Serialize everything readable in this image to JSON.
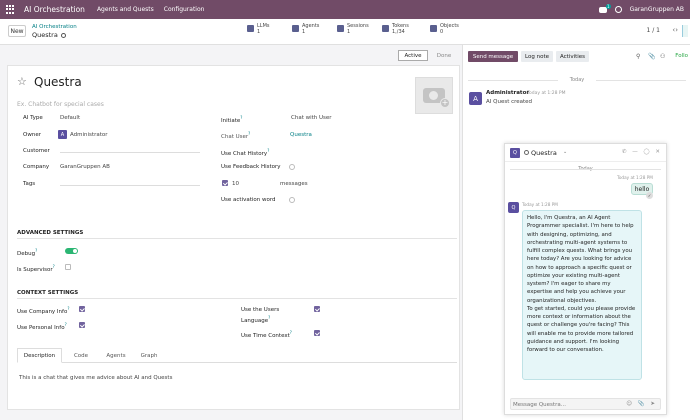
{
  "topbar": {
    "app_name": "AI Orchestration",
    "menu": [
      "Agents and Quests",
      "Configuration"
    ],
    "chat_badge": "1",
    "company": "GaranGruppen AB"
  },
  "controlbar": {
    "new_label": "New",
    "breadcrumb_parent": "AI Orchestration",
    "breadcrumb_current": "Questra",
    "stats": [
      {
        "label": "LLMs",
        "value": "1"
      },
      {
        "label": "Agents",
        "value": "1"
      },
      {
        "label": "Sessions",
        "value": "1"
      },
      {
        "label": "Tokens",
        "value": "1,/34"
      },
      {
        "label": "Objects",
        "value": "0"
      }
    ],
    "pager": "1 / 1"
  },
  "status": {
    "active": "Active",
    "done": "Done"
  },
  "form": {
    "name": "Questra",
    "subtitle": "Ex. Chatbot for special cases",
    "ai_type_label": "AI Type",
    "ai_type_value": "Default",
    "owner_label": "Owner",
    "owner_avatar": "A",
    "owner_value": "Administrator",
    "customer_label": "Customer",
    "company_label": "Company",
    "company_value": "GaranGruppen AB",
    "tags_label": "Tags",
    "initiate_label": "Initiate",
    "initiate_sup": "?",
    "initiate_value": "Chat with User",
    "chat_user_label": "Chat User",
    "chat_user_sup": "?",
    "chat_user_value": "Questra",
    "use_chat_history_label": "Use Chat History",
    "use_chat_history_sup": "?",
    "use_feedback_history_label": "Use Feedback History",
    "messages_count": "10",
    "messages_label": "messages",
    "use_activation_word_label": "Use activation word",
    "advanced_heading": "ADVANCED SETTINGS",
    "debug_label": "Debug",
    "debug_sup": "?",
    "is_supervisor_label": "Is Supervisor",
    "is_supervisor_sup": "?",
    "context_heading": "CONTEXT SETTINGS",
    "use_company_info_label": "Use Company Info",
    "use_company_info_sup": "?",
    "use_personal_info_label": "Use Personal Info",
    "use_personal_info_sup": "?",
    "use_users_language_label": "Use the Users Language",
    "use_users_language_sup": "?",
    "use_time_context_label": "Use Time Context",
    "use_time_context_sup": "?",
    "tabs": [
      "Description",
      "Code",
      "Agents",
      "Graph"
    ],
    "description": "This is a chat that gives me advice about AI and Quests"
  },
  "chatter": {
    "send_message": "Send message",
    "log_note": "Log note",
    "activities": "Activities",
    "follow": "Follo",
    "today": "Today",
    "author": "Administrator",
    "author_avatar": "A",
    "author_time": "Today at 1:28 PM",
    "message": "AI Quest created"
  },
  "chat_window": {
    "avatar": "Q",
    "title": "Questra",
    "today": "Today",
    "user_time": "Today at 1:28 PM",
    "user_message": "hello",
    "bot_avatar": "Q",
    "bot_time": "Today at 1:28 PM",
    "bot_message": "Hello, I'm Questra, an AI Agent Programmer specialist. I'm here to help with designing, optimizing, and orchestrating multi-agent systems to fulfill complex quests. What brings you here today? Are you looking for advice on how to approach a specific quest or optimize your existing multi-agent system? I'm eager to share my expertise and help you achieve your organizational objectives.\nTo get started, could you please provide more context or information about the quest or challenge you're facing? This will enable me to provide more tailored guidance and support. I'm looking forward to our conversation.",
    "composer_placeholder": "Message Questra..."
  }
}
